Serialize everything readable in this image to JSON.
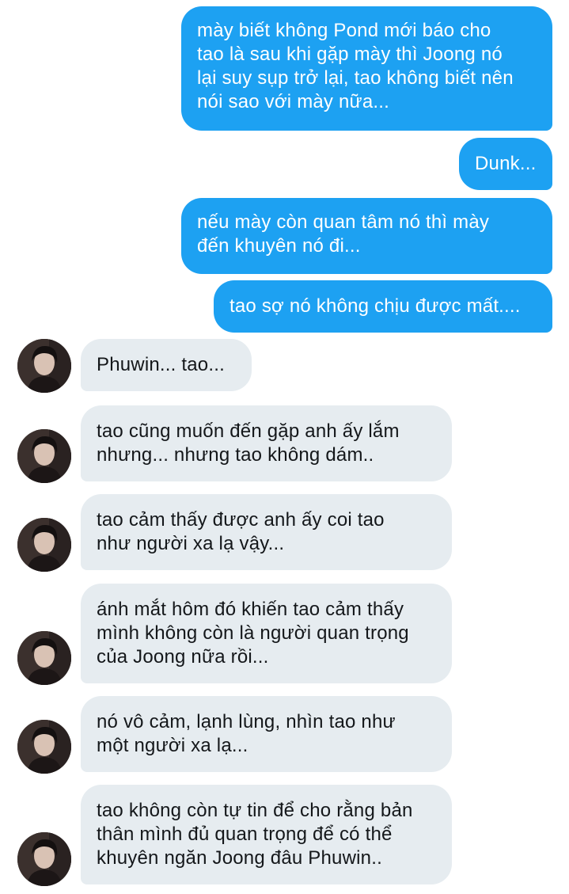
{
  "conversation": {
    "messages": [
      {
        "side": "out",
        "text": "mày biết không Pond mới báo cho\ntao là sau khi gặp mày thì Joong nó\nlại suy sụp trở lại, tao không biết nên\nnói sao với mày nữa..."
      },
      {
        "side": "out",
        "text": "Dunk..."
      },
      {
        "side": "out",
        "text": "nếu mày còn quan tâm nó thì mày\nđến khuyên nó đi..."
      },
      {
        "side": "out",
        "text": "tao sợ nó không chịu được mất...."
      },
      {
        "side": "in",
        "text": "Phuwin... tao..."
      },
      {
        "side": "in",
        "text": "tao cũng muốn đến gặp anh ấy lắm\nnhưng... nhưng tao không dám.."
      },
      {
        "side": "in",
        "text": "tao cảm thấy được anh ấy coi tao\nnhư người xa lạ vậy..."
      },
      {
        "side": "in",
        "text": "ánh mắt hôm đó khiến tao cảm thấy\nmình không còn là người quan trọng\ncủa Joong nữa rồi..."
      },
      {
        "side": "in",
        "text": "nó vô cảm, lạnh lùng, nhìn tao như\nmột người xa lạ..."
      },
      {
        "side": "in",
        "text": "tao không còn tự tin để cho rằng bản\nthân mình đủ quan trọng để có thể\nkhuyên ngăn Joong đâu Phuwin.."
      }
    ]
  },
  "colors": {
    "outgoing_bubble": "#1da1f2",
    "incoming_bubble": "#e6ecf0",
    "background": "#ffffff"
  },
  "icons": {
    "avatar": "contact-avatar-photo"
  }
}
